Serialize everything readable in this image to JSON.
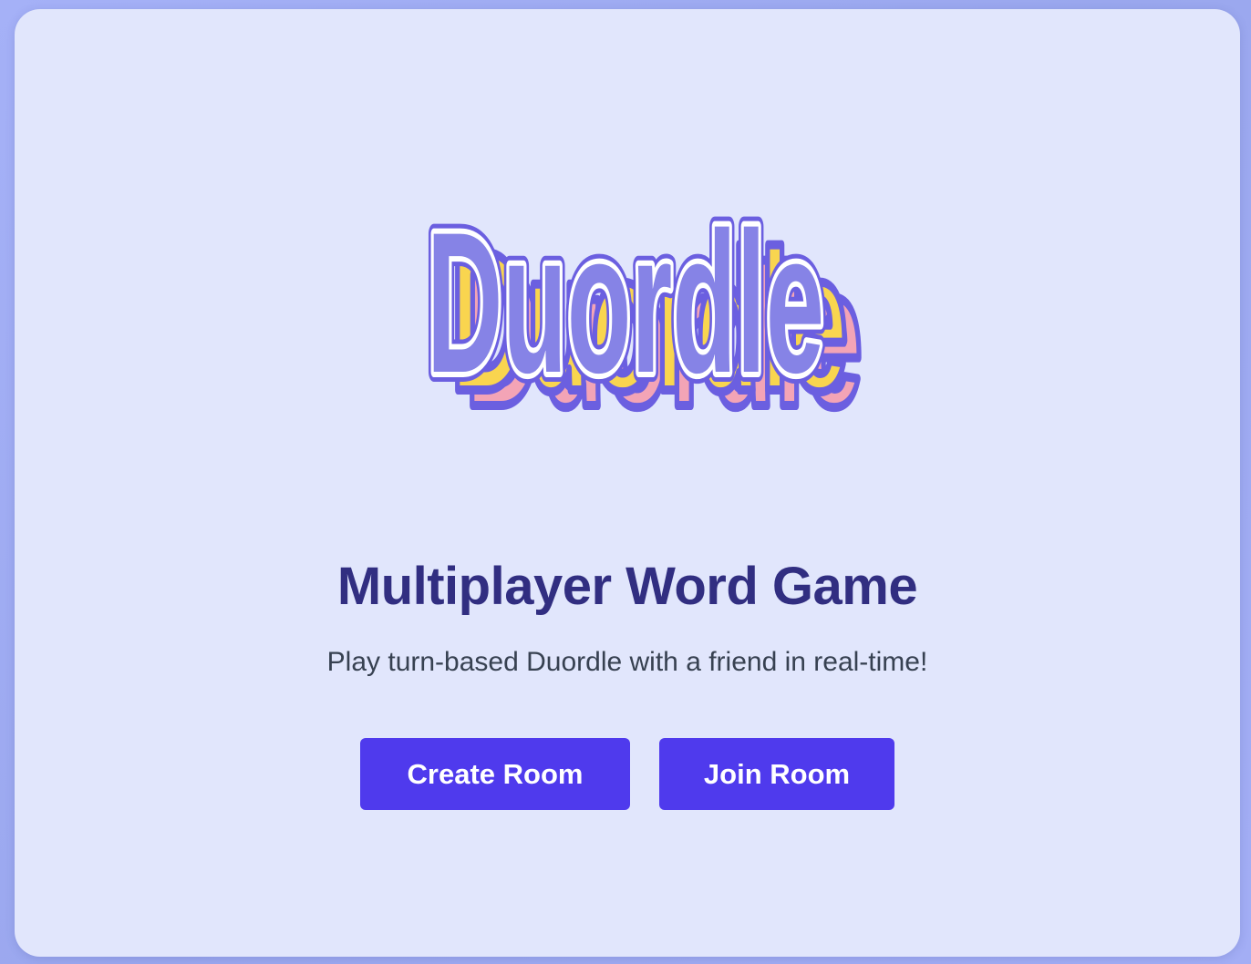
{
  "logo": {
    "text": "Duordle",
    "icon": "duordle-logo",
    "colors": {
      "fill": "#8683e6",
      "outline": "#6b5fe0",
      "inner_stroke": "#ffffff",
      "shadow_yellow": "#f9d54f",
      "shadow_pink": "#f3a4b6"
    }
  },
  "main": {
    "title": "Multiplayer Word Game",
    "subtitle": "Play turn-based Duordle with a friend in real-time!"
  },
  "actions": {
    "create_label": "Create Room",
    "join_label": "Join Room",
    "button_color": "#4f3aed"
  }
}
